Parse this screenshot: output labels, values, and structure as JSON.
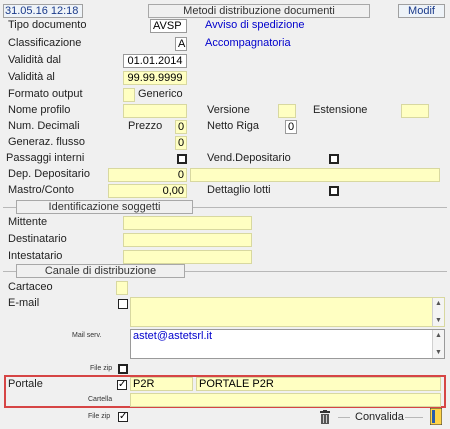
{
  "header": {
    "datetime": "31.05.16 12:18",
    "title": "Metodi distribuzione documenti",
    "mode": "Modif"
  },
  "form": {
    "tipo_documento": {
      "label": "Tipo documento",
      "value": "AVSP",
      "desc": "Avviso di spedizione"
    },
    "classificazione": {
      "label": "Classificazione",
      "value": "A",
      "desc": "Accompagnatoria"
    },
    "validita_dal": {
      "label": "Validità dal",
      "value": "01.01.2014"
    },
    "validita_al": {
      "label": "Validità  al",
      "value": "99.99.9999"
    },
    "formato_output": {
      "label": "Formato output",
      "value": "Generico"
    },
    "nome_profilo": {
      "label": "Nome profilo"
    },
    "versione": {
      "label": "Versione"
    },
    "estensione": {
      "label": "Estensione"
    },
    "num_decimali": {
      "label": "Num. Decimali"
    },
    "prezzo": {
      "label": "Prezzo",
      "value": "0"
    },
    "netto_riga": {
      "label": "Netto Riga",
      "value": "0"
    },
    "generaz_flusso": {
      "label": "Generaz. flusso",
      "value": "0"
    },
    "passaggi_interni": {
      "label": "Passaggi interni"
    },
    "vend_depositario": {
      "label": "Vend.Depositario"
    },
    "dep_depositario": {
      "label": "Dep. Depositario",
      "value": "0"
    },
    "mastro_conto": {
      "label": "Mastro/Conto",
      "value": "0,00"
    },
    "dettaglio_lotti": {
      "label": "Dettaglio lotti"
    }
  },
  "soggetti": {
    "section": "Identificazione soggetti",
    "mittente": "Mittente",
    "destinatario": "Destinatario",
    "intestatario": "Intestatario"
  },
  "canale": {
    "section": "Canale di distribuzione",
    "cartaceo": "Cartaceo",
    "email": "E-mail",
    "mail_serv_label": "Mail serv.",
    "mail_serv_value": "astet@astetsrl.it",
    "file_zip_label": "File zip",
    "portale_label": "Portale",
    "portale_check": "✓",
    "portale_code": "P2R",
    "portale_desc": "PORTALE P2R",
    "cartella_label": "Cartella",
    "file_zip2_label": "File zip",
    "file_zip2_check": "✓",
    "convalida": "Convalida"
  },
  "colors": {
    "field_bg": "#ffffc2",
    "highlight_border": "#d64545",
    "link_blue": "#0000cc"
  },
  "icons": [
    "trash-icon",
    "bookmark-icon",
    "scroll-up-icon",
    "scroll-down-icon"
  ]
}
